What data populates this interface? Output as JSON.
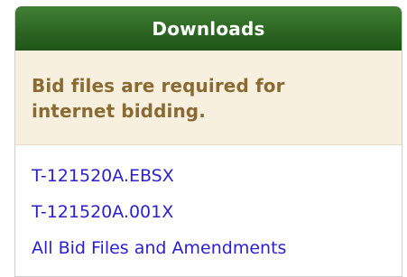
{
  "panel": {
    "title": "Downloads",
    "notice": {
      "line1": "Bid files are required for",
      "line2": "internet bidding."
    },
    "links": [
      {
        "label": "T-121520A.EBSX"
      },
      {
        "label": "T-121520A.001X"
      },
      {
        "label": "All Bid Files and Amendments"
      }
    ]
  },
  "colors": {
    "header_green": "#2f6a25",
    "notice_bg": "#f7f0df",
    "notice_text": "#8b6a32",
    "link_blue": "#2a1fd1"
  }
}
